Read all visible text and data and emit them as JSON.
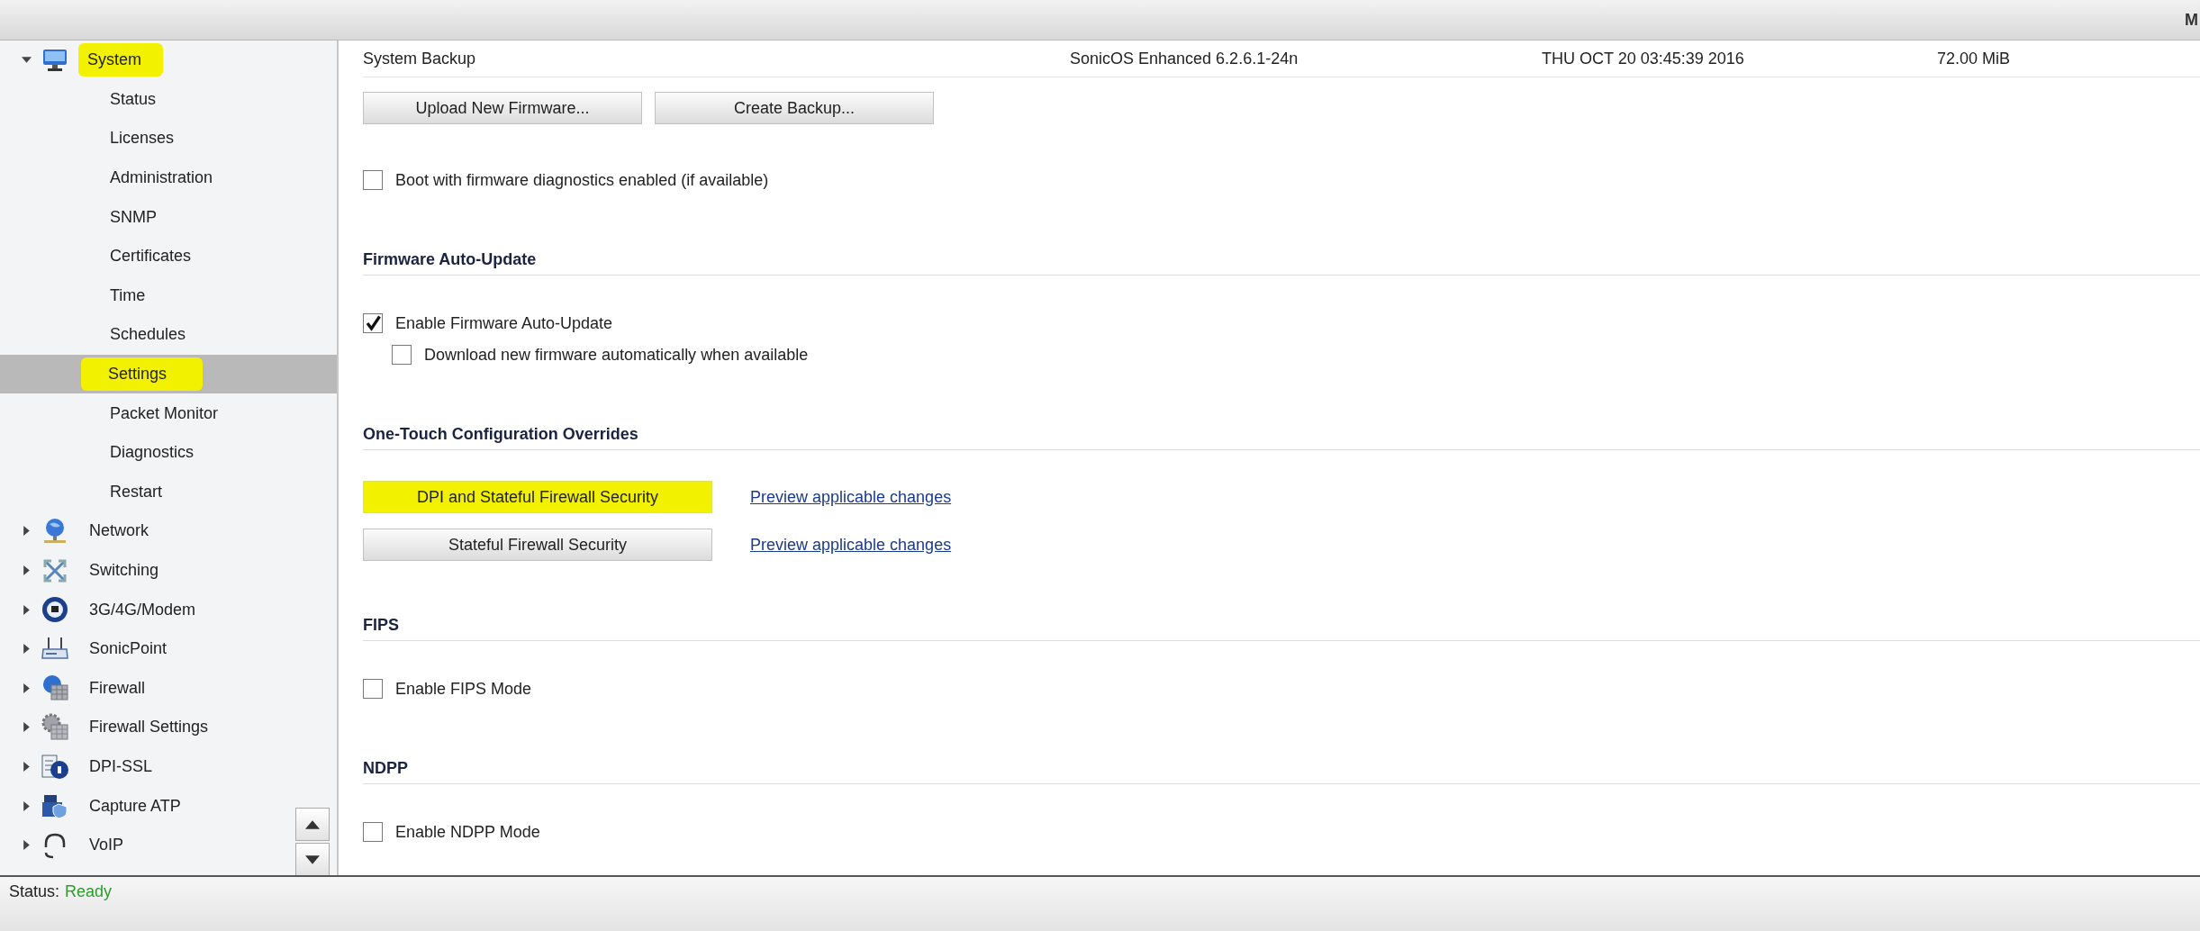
{
  "header": {
    "column_5": "M"
  },
  "sidebar": {
    "items": [
      {
        "label": "System",
        "expanded": true,
        "highlighted": true,
        "children": [
          {
            "label": "Status",
            "selected": false,
            "highlighted": false
          },
          {
            "label": "Licenses",
            "selected": false,
            "highlighted": false
          },
          {
            "label": "Administration",
            "selected": false,
            "highlighted": false
          },
          {
            "label": "SNMP",
            "selected": false,
            "highlighted": false
          },
          {
            "label": "Certificates",
            "selected": false,
            "highlighted": false
          },
          {
            "label": "Time",
            "selected": false,
            "highlighted": false
          },
          {
            "label": "Schedules",
            "selected": false,
            "highlighted": false
          },
          {
            "label": "Settings",
            "selected": true,
            "highlighted": true
          },
          {
            "label": "Packet Monitor",
            "selected": false,
            "highlighted": false
          },
          {
            "label": "Diagnostics",
            "selected": false,
            "highlighted": false
          },
          {
            "label": "Restart",
            "selected": false,
            "highlighted": false
          }
        ]
      },
      {
        "label": "Network",
        "expanded": false,
        "highlighted": false
      },
      {
        "label": "Switching",
        "expanded": false,
        "highlighted": false
      },
      {
        "label": "3G/4G/Modem",
        "expanded": false,
        "highlighted": false
      },
      {
        "label": "SonicPoint",
        "expanded": false,
        "highlighted": false
      },
      {
        "label": "Firewall",
        "expanded": false,
        "highlighted": false
      },
      {
        "label": "Firewall Settings",
        "expanded": false,
        "highlighted": false
      },
      {
        "label": "DPI-SSL",
        "expanded": false,
        "highlighted": false
      },
      {
        "label": "Capture ATP",
        "expanded": false,
        "highlighted": false
      },
      {
        "label": "VoIP",
        "expanded": false,
        "highlighted": false
      }
    ]
  },
  "main": {
    "blocks": [
      {
        "kind": "table_row",
        "cells": [
          "System Backup",
          "SonicOS Enhanced 6.2.6.1-24n",
          "THU OCT 20 03:45:39 2016",
          "72.00 MiB"
        ]
      },
      {
        "kind": "buttons",
        "buttons": [
          "Upload New Firmware...",
          "Create Backup..."
        ]
      },
      {
        "kind": "checkbox",
        "label": "Boot with firmware diagnostics enabled (if available)",
        "checked": false
      },
      {
        "kind": "heading",
        "label": "Firmware Auto-Update"
      },
      {
        "kind": "checkbox",
        "label": "Enable Firmware Auto-Update",
        "checked": true,
        "children": [
          {
            "label": "Download new firmware automatically when available",
            "checked": false
          }
        ]
      },
      {
        "kind": "heading",
        "label": "One-Touch Configuration Overrides"
      },
      {
        "kind": "override",
        "button": "DPI and Stateful Firewall Security",
        "highlighted": true,
        "link": "Preview applicable changes"
      },
      {
        "kind": "override",
        "button": "Stateful Firewall Security",
        "highlighted": false,
        "link": "Preview applicable changes"
      },
      {
        "kind": "heading",
        "label": "FIPS"
      },
      {
        "kind": "checkbox",
        "label": "Enable FIPS Mode",
        "checked": false
      },
      {
        "kind": "heading",
        "label": "NDPP"
      },
      {
        "kind": "checkbox",
        "label": "Enable NDPP Mode",
        "checked": false
      }
    ]
  },
  "status_bar": {
    "label": "Status:",
    "value": "Ready"
  }
}
